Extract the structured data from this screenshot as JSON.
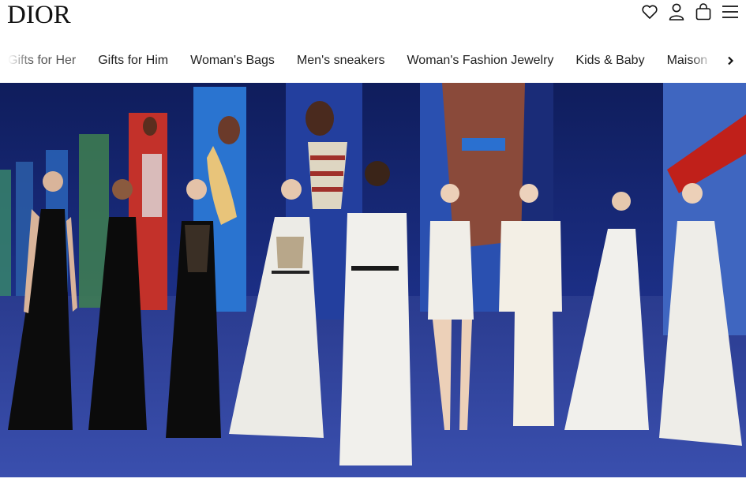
{
  "brand": {
    "logo_text": "DIOR"
  },
  "header": {
    "icons": [
      "heart-icon",
      "account-icon",
      "shopping-bag-icon",
      "menu-icon"
    ]
  },
  "nav": {
    "items": [
      {
        "label": "Gifts for Her"
      },
      {
        "label": "Gifts for Him"
      },
      {
        "label": "Woman's Bags"
      },
      {
        "label": "Men's sneakers"
      },
      {
        "label": "Woman's Fashion Jewelry"
      },
      {
        "label": "Kids & Baby"
      },
      {
        "label": "Maison"
      }
    ],
    "next_icon": "chevron-right-icon"
  },
  "hero": {
    "colors": {
      "background": "#1a2a78",
      "floor": "#2a3a8a",
      "black_dress": "#0c0c0c",
      "white_dress": "#eeeeea"
    }
  }
}
